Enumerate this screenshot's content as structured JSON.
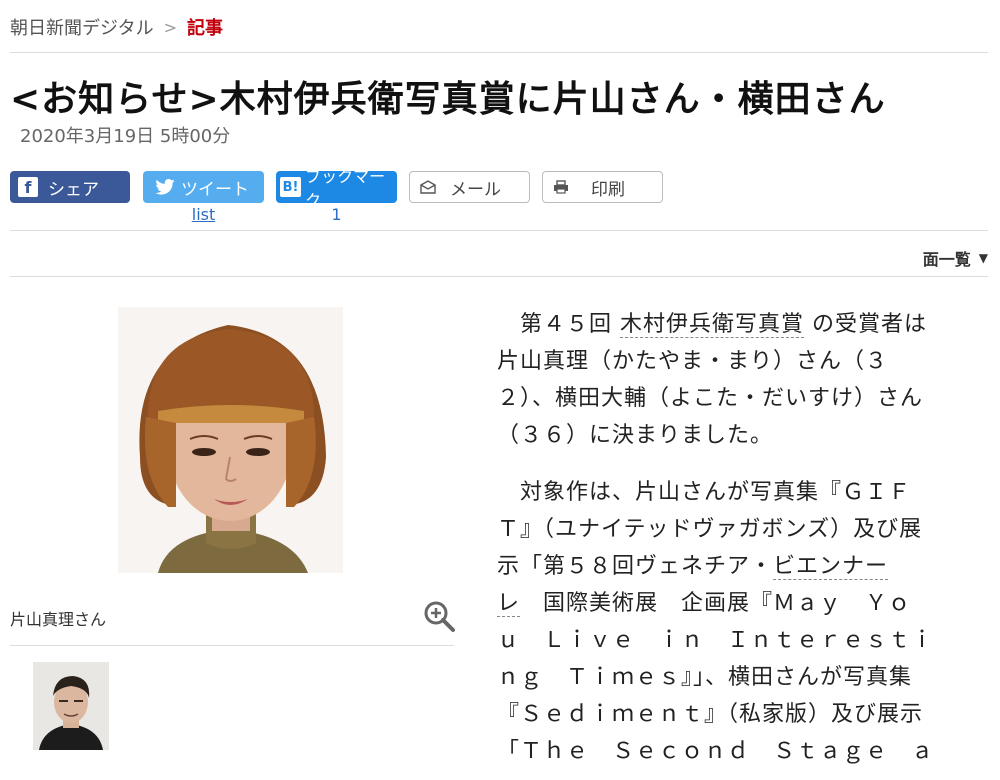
{
  "breadcrumb": {
    "site": "朝日新聞デジタル",
    "separator": ">",
    "current": "記事"
  },
  "article": {
    "title": "<お知らせ>木村伊兵衛写真賞に片山さん・横田さん",
    "date": "2020年3月19日 5時00分",
    "body": {
      "p1_l1_a": "第４５回 ",
      "p1_l1_link": "木村伊兵衛写真賞",
      "p1_l1_b": " の受賞者は",
      "p1_l2": "片山真理（かたやま・まり）さん（３",
      "p1_l3": "２）、横田大輔（よこた・だいすけ）さん",
      "p1_l4": "（３６）に決まりました。",
      "p2_l1": "対象作は、片山さんが写真集『ＧＩＦ",
      "p2_l2": "Ｔ』（ユナイテッドヴァガボンズ）及び展",
      "p2_l3_a": "示「第５８回ヴェネチア・",
      "p2_l3_link": "ビエンナー",
      "p2_l4_link": "レ",
      "p2_l4_b": "　国際美術展　企画展『Ｍａｙ　Ｙｏ",
      "p2_l5": "ｕ　Ｌｉｖｅ　ｉｎ　Ｉｎｔｅｒｅｓｔｉ",
      "p2_l6": "ｎｇ　Ｔｉｍｅｓ』」、横田さんが写真集",
      "p2_l7": "『Ｓｅｄｉｍｅｎｔ』（私家版）及び展示",
      "p2_l8": "「Ｔｈｅ　Ｓｅｃｏｎｄ　Ｓｔａｇｅ　ａ"
    }
  },
  "share": {
    "facebook_label": "シェア",
    "twitter_label": "ツイート",
    "twitter_count": "list",
    "hatena_label": "ブックマーク",
    "hatena_count": "1",
    "mail_label": "メール",
    "print_label": "印刷"
  },
  "men_ichiran": {
    "label": "面一覧",
    "arrow": "▼"
  },
  "photo": {
    "caption": "片山真理さん"
  },
  "colors": {
    "accent_red": "#c0000c",
    "facebook": "#3b5998",
    "twitter": "#55acee",
    "hatena": "#1e88e5",
    "link_blue": "#2b6cc4"
  },
  "icons": {
    "facebook": "facebook-icon",
    "twitter": "twitter-bird-icon",
    "hatena": "hatena-bookmark-icon",
    "mail": "mail-icon",
    "print": "printer-icon",
    "zoom": "zoom-in-icon",
    "menu": "triangle-down-icon"
  }
}
